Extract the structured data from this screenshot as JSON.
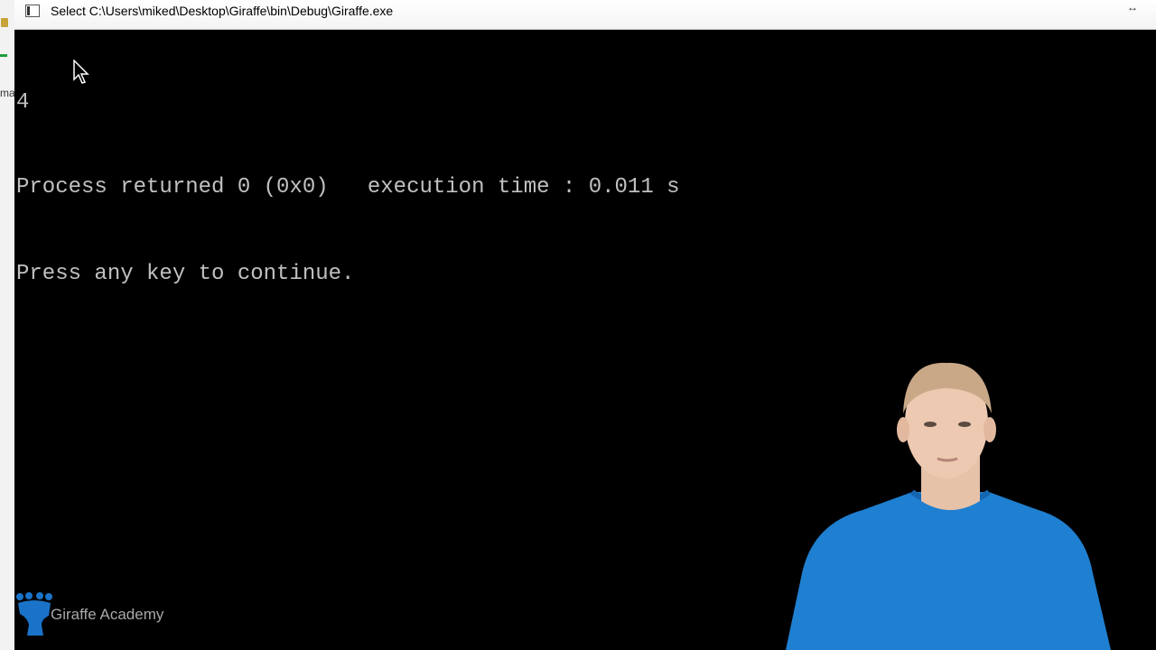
{
  "window": {
    "title": "Select C:\\Users\\miked\\Desktop\\Giraffe\\bin\\Debug\\Giraffe.exe",
    "resize_glyph": "↔"
  },
  "ide_strip": {
    "partial_label": "ma"
  },
  "console": {
    "lines": [
      "4",
      "Process returned 0 (0x0)   execution time : 0.011 s",
      "Press any key to continue."
    ],
    "text_color": "#c0c0c0",
    "background": "#000000"
  },
  "icons": {
    "app": "console-app-icon",
    "cursor": "mouse-cursor-icon",
    "logo": "giraffe-logo-icon"
  },
  "watermark": {
    "brand": "Giraffe Academy",
    "color": "#a8a8a8"
  },
  "presenter": {
    "shirt_color": "#1f7fd0"
  }
}
